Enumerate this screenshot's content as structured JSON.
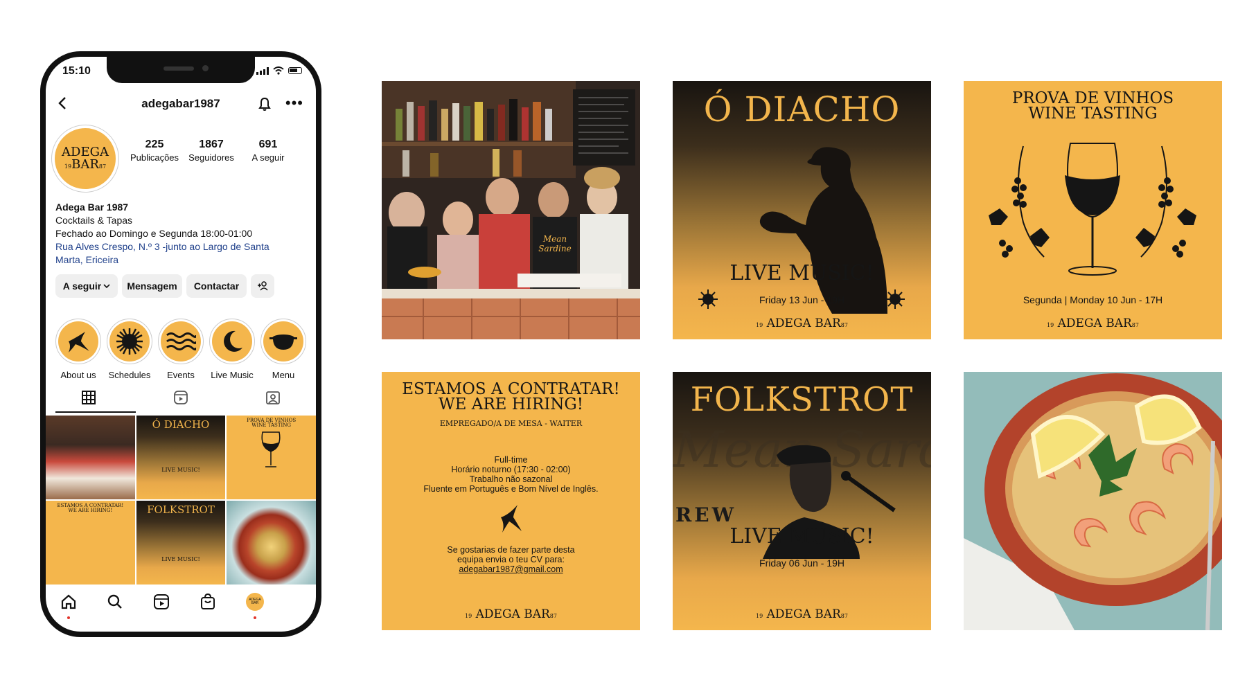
{
  "phone": {
    "time": "15:10",
    "username": "adegabar1987",
    "avatar": {
      "line1": "ADEGA",
      "line2": "BAR",
      "yr1": "19",
      "yr2": "87"
    },
    "stats": [
      {
        "value": "225",
        "label": "Publicações"
      },
      {
        "value": "1867",
        "label": "Seguidores"
      },
      {
        "value": "691",
        "label": "A seguir"
      }
    ],
    "bio": {
      "name": "Adega Bar 1987",
      "category": "Cocktails & Tapas",
      "hours": "Fechado ao Domingo e Segunda 18:00-01:00",
      "address_line1": "Rua Alves Crespo, N.º 3 -junto ao Largo de Santa",
      "address_line2": "Marta, Ericeira"
    },
    "buttons": {
      "follow": "A seguir",
      "message": "Mensagem",
      "contact": "Contactar"
    },
    "highlights": [
      {
        "label": "About us",
        "icon": "swallow-icon"
      },
      {
        "label": "Schedules",
        "icon": "sun-icon"
      },
      {
        "label": "Events",
        "icon": "waves-icon"
      },
      {
        "label": "Live Music",
        "icon": "moon-icon"
      },
      {
        "label": "Menu",
        "icon": "pot-icon"
      }
    ]
  },
  "posts": {
    "diacho": {
      "title": "Ó DIACHO",
      "subtitle": "LIVE MUSIC!",
      "date": "Friday 13 Jun - 19H"
    },
    "wine": {
      "title1": "PROVA DE VINHOS",
      "title2": "WINE TASTING",
      "date": "Segunda | Monday 10 Jun - 17H"
    },
    "hiring": {
      "title1": "ESTAMOS A CONTRATAR!",
      "title2": "WE ARE HIRING!",
      "role": "EMPREGADO/A DE MESA - WAITER",
      "line1": "Full-time",
      "line2": "Horário noturno (17:30 - 02:00)",
      "line3": "Trabalho não sazonal",
      "line4": "Fluente em Português e Bom Nível de Inglês.",
      "cta1": "Se gostarias de fazer parte desta",
      "cta2": "equipa envia o teu CV para:",
      "email": "adegabar1987@gmail.com"
    },
    "folk": {
      "title": "FOLKSTROT",
      "bg_text": "Mean Sardine",
      "bg_text2": "REW",
      "subtitle": "LIVE MUSIC!",
      "date": "Friday 06 Jun - 19H"
    },
    "brand": {
      "name": "ADEGA BAR",
      "yr1": "19",
      "yr2": "87"
    }
  },
  "colors": {
    "brand_yellow": "#f4b64c",
    "ink": "#151515",
    "link_blue": "#1e3f8a",
    "notify_red": "#e2342b"
  }
}
